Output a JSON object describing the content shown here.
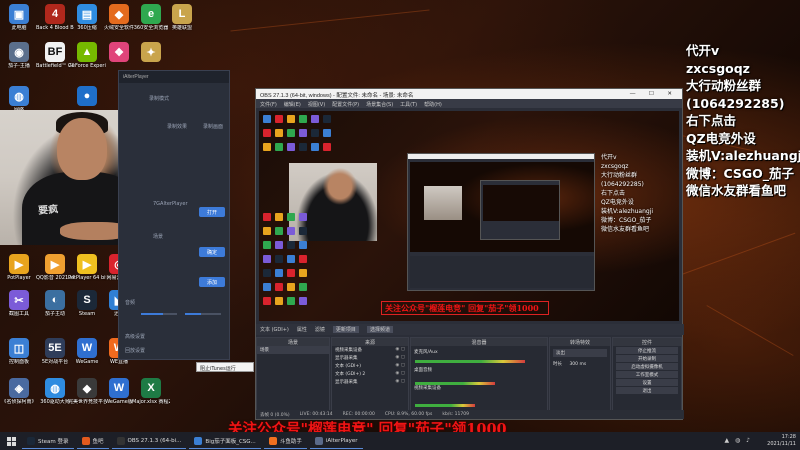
{
  "desktop_icons": [
    {
      "label": "此电脑",
      "glyph": "▣",
      "color": "#3b7fd4"
    },
    {
      "label": "Back 4 Blood Beta",
      "glyph": "4",
      "color": "#b0281c"
    },
    {
      "label": "360压缩",
      "glyph": "▤",
      "color": "#2f8ce0"
    },
    {
      "label": "火绒安全软件",
      "glyph": "◆",
      "color": "#e46b1e"
    },
    {
      "label": "360安全浏览器",
      "glyph": "e",
      "color": "#2fa84f"
    },
    {
      "label": "英雄联盟",
      "glyph": "L",
      "color": "#c9a44c"
    },
    {
      "label": "茄子-主播",
      "glyph": "◉",
      "color": "#5b6f8c"
    },
    {
      "label": "Battlefield™ 2042 Ope...",
      "glyph": "BF",
      "color": "#f2f2f2"
    },
    {
      "label": "GeForce Experience",
      "glyph": "▲",
      "color": "#76b900"
    },
    {
      "label": "",
      "glyph": "❖",
      "color": "#e0447a"
    },
    {
      "label": "",
      "glyph": "✦",
      "color": "#c9a44c"
    },
    {
      "label": "网络",
      "glyph": "◍",
      "color": "#3b7fd4"
    },
    {
      "label": "",
      "glyph": "●",
      "color": "#1f6fc9"
    },
    {
      "label": "PotPlayer",
      "glyph": "▶",
      "color": "#e8a41e"
    },
    {
      "label": "QQ影音 20210415...",
      "glyph": "▶",
      "color": "#f0a030"
    },
    {
      "label": "PotPlayer 64 bit",
      "glyph": "▶",
      "color": "#f0c020"
    },
    {
      "label": "网易云音乐",
      "glyph": "◎",
      "color": "#d9232d"
    },
    {
      "label": "截图工具",
      "glyph": "✂",
      "color": "#7b5bd8"
    },
    {
      "label": "茄子主动",
      "glyph": "◐",
      "color": "#3b6fa0"
    },
    {
      "label": "Steam",
      "glyph": "S",
      "color": "#1b2838"
    },
    {
      "label": "迅雷",
      "glyph": "◣",
      "color": "#2f7fd4"
    },
    {
      "label": "控制面板",
      "glyph": "◫",
      "color": "#3b7fd4"
    },
    {
      "label": "5E对战平台",
      "glyph": "5E",
      "color": "#2f3d5a"
    },
    {
      "label": "WeGame",
      "glyph": "W",
      "color": "#2f6fd0"
    },
    {
      "label": "WE直播",
      "glyph": "W",
      "color": "#f06a1e"
    },
    {
      "label": "《名侦探柯南》",
      "glyph": "◈",
      "color": "#4a6aa0"
    },
    {
      "label": "360驱动大师",
      "glyph": "◍",
      "color": "#2f8ce0"
    },
    {
      "label": "完美世界竞技平台",
      "glyph": "◆",
      "color": "#3a3a3a"
    },
    {
      "label": "WeGame版",
      "glyph": "W",
      "color": "#2f6fd0"
    },
    {
      "label": "Major.xlsx 赛程2",
      "glyph": "X",
      "color": "#1e7b45"
    }
  ],
  "ialter": {
    "title": "iAlterPlayer",
    "header_text": "自定义",
    "labels": [
      "录制模式",
      "录制效果",
      "录制画面",
      "场景",
      "7GAlterPlayer",
      "打开",
      "设置",
      "清除",
      "音频",
      "高级设置",
      "回放设置"
    ],
    "btn_open": "打开",
    "btn_mode": "确定",
    "btn_add": "添加"
  },
  "obs": {
    "title": "OBS 27.1.3 (64-bit, windows) - 配置文件: 未命名 - 场景: 未命名",
    "menu": [
      "文件(F)",
      "编辑(E)",
      "视图(V)",
      "配置文件(P)",
      "场景集合(S)",
      "工具(T)",
      "帮助(H)"
    ],
    "toolbar": [
      "文本 (GDI+)",
      "属性",
      "滤镜",
      "更新项目",
      "选择频道"
    ],
    "scenes_header": "场景",
    "scenes": [
      "场景"
    ],
    "sources_header": "来源",
    "sources": [
      "视频采集设备",
      "显示器采集",
      "文本 (GDI+)",
      "文本 (GDI+) 2",
      "显示器采集"
    ],
    "mixer_header": "混音器",
    "mixer": [
      "麦克风/Aux",
      "桌面音频",
      "视频采集设备"
    ],
    "transitions_header": "转场特效",
    "transition_value": "淡出",
    "transition_duration_label": "时长",
    "transition_duration": "300 ms",
    "controls_header": "控件",
    "controls": [
      "停止推流",
      "开始录制",
      "启动虚拟摄像机",
      "工作室模式",
      "设置",
      "退出"
    ],
    "status": [
      "丢帧 0 (0.0%)",
      "LIVE: 00:43:14",
      "REC: 00:00:00",
      "CPU: 8.9%, 60.00 fps",
      "kb/s: 11709"
    ],
    "preview_overlay_small": [
      "代开v",
      "zxcsgoqz",
      "大行动粉丝群",
      "(1064292285)",
      "右下点击",
      "QZ电竞外设",
      "装机V:alezhuangji",
      "微博：CSGO_茄子",
      "微信水友群看鱼吧"
    ],
    "preview_banner": "关注公众号\"榴莲电竞\" 回复\"茄子\"领1000"
  },
  "tooltip": "阻止iTunes运行",
  "overlay_right": [
    "代开v",
    "zxcsgoqz",
    "大行动粉丝群",
    "(1064292285)",
    "右下点击",
    "QZ电竞外设",
    "装机V:alezhuangji",
    "微博：CSGO_茄子",
    "微信水友群看鱼吧"
  ],
  "bottom_banner": "关注公众号\"榴莲电竞\" 回复\"茄子\"领1000",
  "taskbar": {
    "items": [
      {
        "label": "Steam 登录",
        "color": "#1b2838"
      },
      {
        "label": "鱼吧",
        "color": "#e25a1e"
      },
      {
        "label": "OBS 27.1.3 (64-bi...",
        "color": "#333"
      },
      {
        "label": "Big茄子面板_CSG...",
        "color": "#3b7fd4"
      },
      {
        "label": "斗鱼助手",
        "color": "#f07020"
      },
      {
        "label": "iAlterPlayer",
        "color": "#5a6a8a"
      }
    ],
    "time": "17:28",
    "date": "2021/11/11"
  },
  "colors": {
    "banner_red": "#f01414",
    "obs_bg": "#2b2e38",
    "accent_blue": "#3d7bd9"
  }
}
